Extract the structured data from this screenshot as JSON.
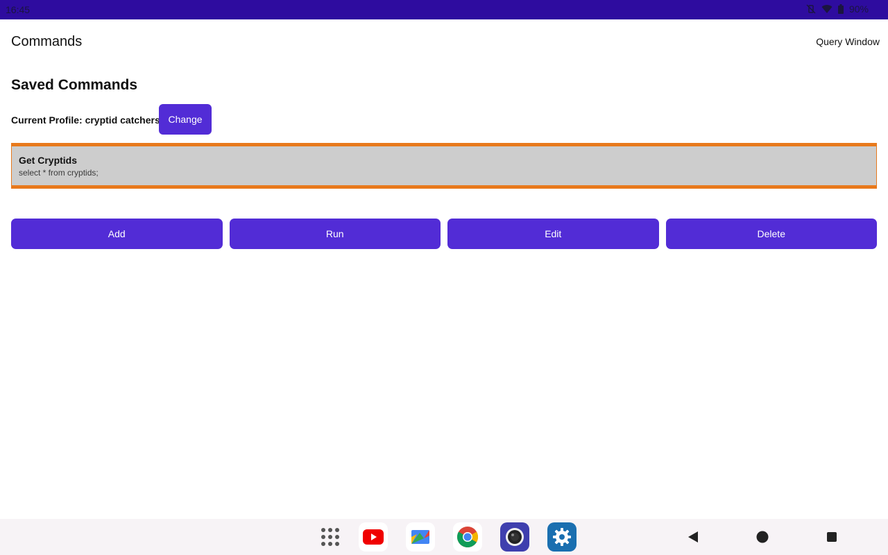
{
  "status_bar": {
    "time": "16:45",
    "battery": "90%",
    "icons": [
      "vibrate-off-icon",
      "wifi-icon",
      "battery-icon"
    ]
  },
  "app_bar": {
    "title": "Commands",
    "query_window_label": "Query Window"
  },
  "main": {
    "heading": "Saved Commands",
    "profile_label": "Current Profile: cryptid catchers",
    "change_label": "Change",
    "commands": [
      {
        "name": "Get Cryptids",
        "query": "select * from cryptids;"
      }
    ],
    "actions": {
      "add": "Add",
      "run": "Run",
      "edit": "Edit",
      "delete": "Delete"
    }
  },
  "taskbar": {
    "apps": [
      "app-drawer-icon",
      "youtube-icon",
      "files-icon",
      "chrome-icon",
      "camera-icon",
      "settings-icon"
    ],
    "nav": [
      "back-icon",
      "home-icon",
      "recents-icon"
    ]
  },
  "colors": {
    "accent": "#522cd6",
    "status_bar": "#2e0c9f",
    "selection_border": "#e8791c",
    "selection_bg": "#cdcdcd"
  }
}
